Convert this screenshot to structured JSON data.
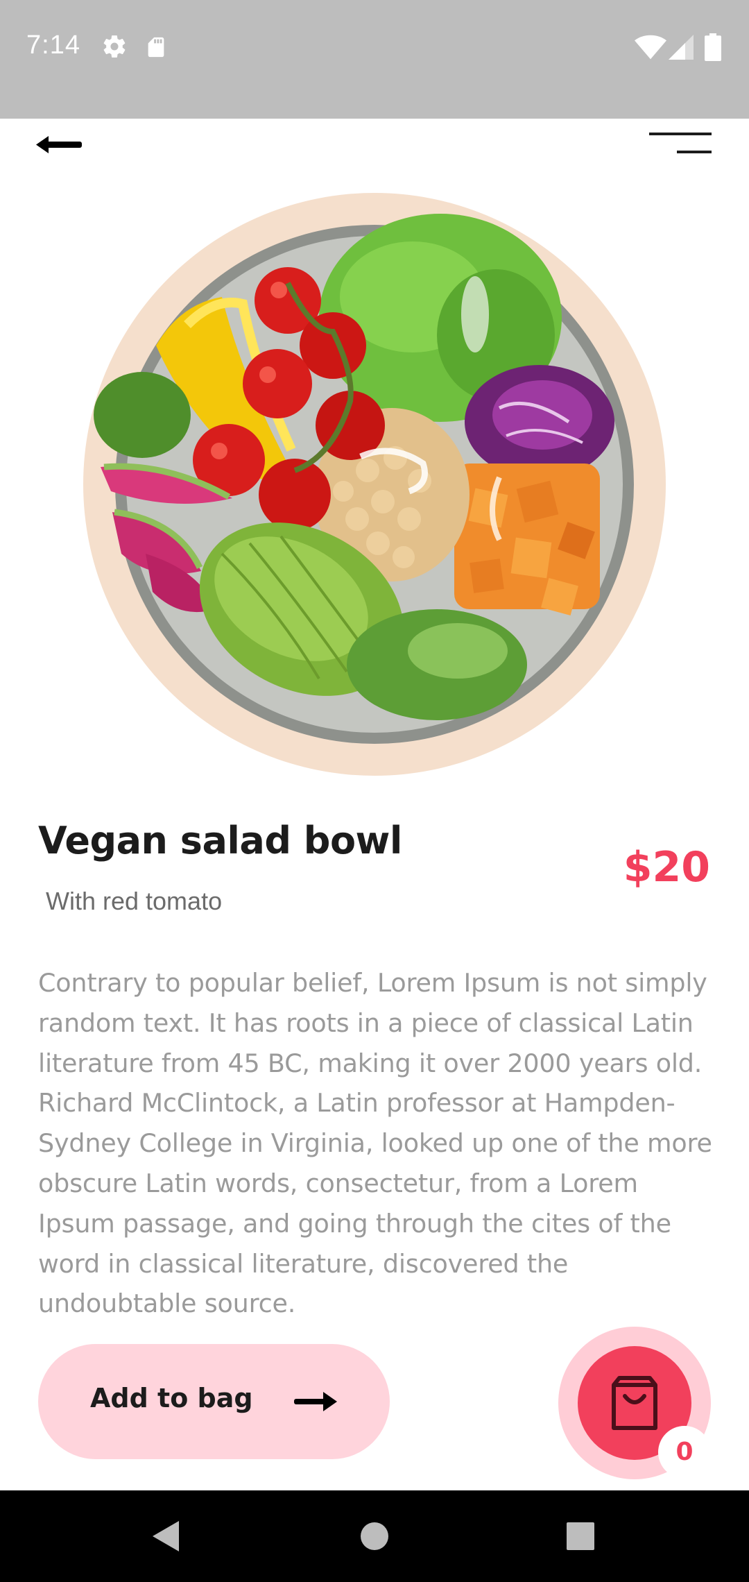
{
  "status_bar": {
    "time": "7:14",
    "icons": [
      "settings-icon",
      "sd-card-icon",
      "wifi-icon",
      "signal-icon",
      "battery-icon"
    ]
  },
  "app_bar": {
    "back_icon": "arrow-left-icon",
    "menu_icon": "menu-icon"
  },
  "product": {
    "image": "vegan-salad-bowl-image",
    "title": "Vegan salad bowl",
    "subtitle": "With red tomato",
    "price": "$20",
    "description": "Contrary to popular belief, Lorem Ipsum is not simply random text. It has roots in a piece of classical Latin literature from 45 BC, making it over 2000 years old. Richard McClintock, a Latin professor at Hampden-Sydney College in Virginia, looked up one of the more obscure Latin words, consectetur, from a Lorem Ipsum passage, and going through the cites of the word in classical literature, discovered the undoubtable source."
  },
  "actions": {
    "add_to_bag_label": "Add to bag",
    "cart_count": "0"
  },
  "colors": {
    "accent": "#f2405c",
    "accent_light": "#ffd4dc",
    "plate_ring": "#f5dfcc",
    "status_bar": "#bdbdbd",
    "nav_bar": "#000000"
  },
  "nav": {
    "buttons": [
      "back-triangle-icon",
      "home-circle-icon",
      "recents-square-icon"
    ]
  }
}
